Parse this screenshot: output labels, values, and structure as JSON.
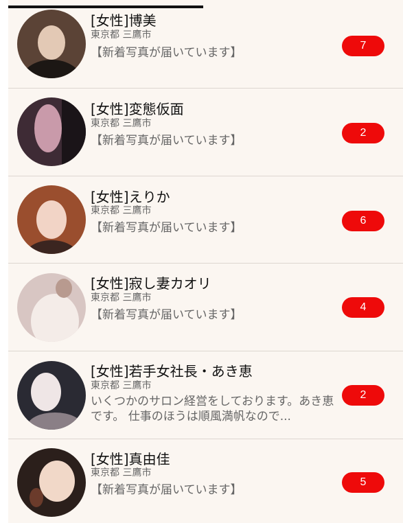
{
  "rows": [
    {
      "name": "[女性]博美",
      "location": "東京都 三鷹市",
      "message": "【新着写真が届いています】",
      "badge": "7",
      "avatar_colors": [
        "#5b4336",
        "#1c1714",
        "#e3c9b5"
      ]
    },
    {
      "name": "[女性]変態仮面",
      "location": "東京都 三鷹市",
      "message": "【新着写真が届いています】",
      "badge": "2",
      "avatar_colors": [
        "#3e2b35",
        "#c99aaa",
        "#1a1418"
      ]
    },
    {
      "name": "[女性]えりか",
      "location": "東京都 三鷹市",
      "message": "【新着写真が届いています】",
      "badge": "6",
      "avatar_colors": [
        "#9a4e2e",
        "#f2d4c6",
        "#3b2520"
      ]
    },
    {
      "name": "[女性]寂し妻カオリ",
      "location": "東京都 三鷹市",
      "message": "【新着写真が届いています】",
      "badge": "4",
      "avatar_colors": [
        "#d8c6c3",
        "#f4ece8",
        "#b89a8f"
      ]
    },
    {
      "name": "[女性]若手女社長・あき恵",
      "location": "東京都 三鷹市",
      "message": "いくつかのサロン経営をしております。あき恵です。 仕事のほうは順風満帆なので...",
      "badge": "2",
      "avatar_colors": [
        "#2a2a33",
        "#efe6e6",
        "#8a7f86"
      ]
    },
    {
      "name": "[女性]真由佳",
      "location": "東京都 三鷹市",
      "message": "【新着写真が届いています】",
      "badge": "5",
      "avatar_colors": [
        "#2b1f1b",
        "#f1d8c8",
        "#6b3b2b"
      ]
    }
  ]
}
